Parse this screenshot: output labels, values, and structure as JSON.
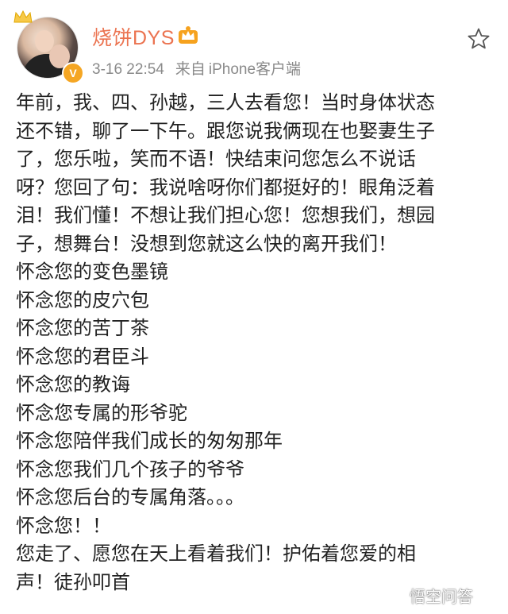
{
  "post": {
    "author": "烧饼DYS",
    "timestamp": "3-16 22:54",
    "source_prefix": "来自",
    "source_device": "iPhone客户端",
    "verified_mark": "V",
    "lines": [
      "年前，我、四、孙越，三人去看您！当时身体状态",
      "还不错，聊了一下午。跟您说我俩现在也娶妻生子",
      "了，您乐啦，笑而不语！快结束问您怎么不说话",
      "呀？您回了句：我说啥呀你们都挺好的！眼角泛着",
      "泪！我们懂！不想让我们担心您！您想我们，想园",
      "子，想舞台！没想到您就这么快的离开我们！",
      "怀念您的变色墨镜",
      "怀念您的皮穴包",
      "怀念您的苦丁茶",
      "怀念您的君臣斗",
      "怀念您的教诲",
      "怀念您专属的形爷驼",
      "怀念您陪伴我们成长的匆匆那年",
      "怀念您我们几个孩子的爷爷",
      "怀念您后台的专属角落。。。",
      "怀念您！！",
      "您走了、愿您在天上看着我们！护佑着您爱的相",
      "声！徒孙叩首"
    ]
  },
  "watermark": {
    "text": "悟空问答"
  },
  "colors": {
    "username": "#eb7350",
    "meta": "#8a8a8a",
    "verified": "#f5a623",
    "body_text": "#222222"
  },
  "icons": {
    "favorite": "star-outline-icon",
    "member": "crown-badge-icon",
    "verified": "verified-v-icon"
  }
}
